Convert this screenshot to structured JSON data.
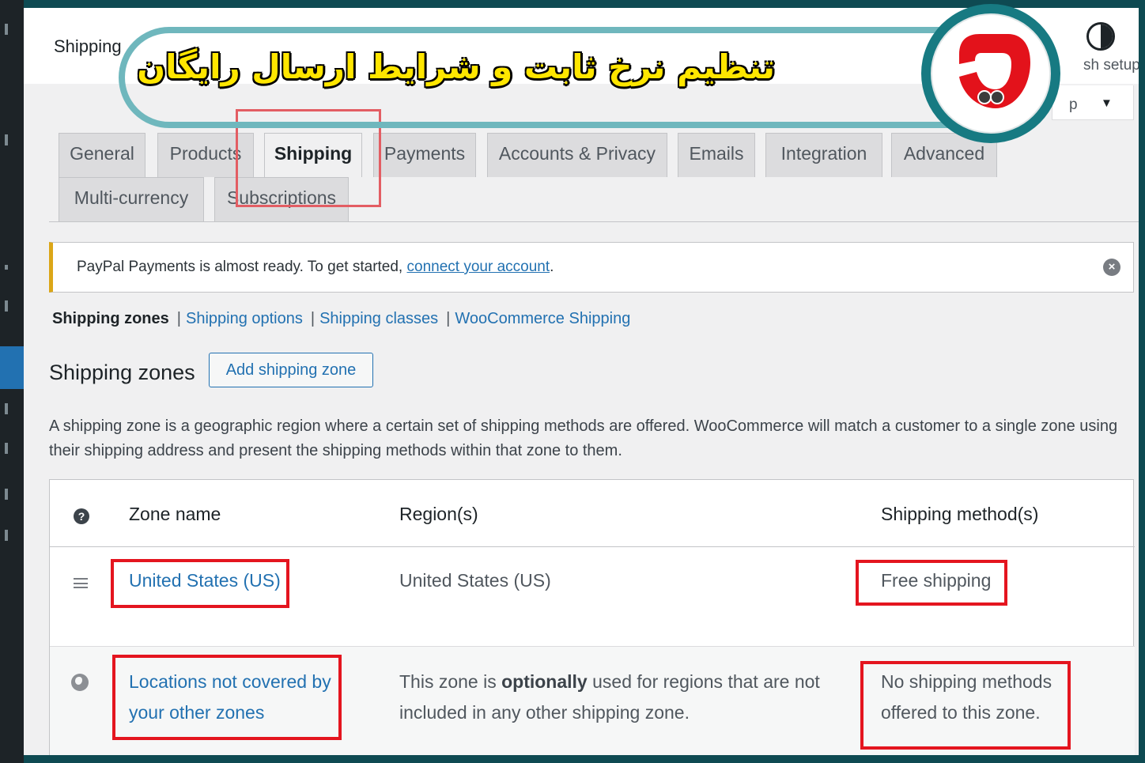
{
  "header": {
    "page_title": "Shipping",
    "finish_setup": "sh setup",
    "help_label": "p",
    "help_caret": "▼"
  },
  "banner": {
    "text": "تنظیم نرخ ثابت و شرایط ارسال رایگان"
  },
  "tabs": [
    {
      "label": "General"
    },
    {
      "label": "Products"
    },
    {
      "label": "Shipping"
    },
    {
      "label": "Payments"
    },
    {
      "label": "Accounts & Privacy"
    },
    {
      "label": "Emails"
    },
    {
      "label": "Integration"
    },
    {
      "label": "Advanced"
    },
    {
      "label": "Multi-currency"
    },
    {
      "label": "Subscriptions"
    }
  ],
  "notice": {
    "text": "PayPal Payments is almost ready. To get started, ",
    "link": "connect your account",
    "suffix": ".",
    "close_glyph": "×"
  },
  "subnav": {
    "current": "Shipping zones",
    "separator": "|",
    "links": [
      "Shipping options",
      "Shipping classes",
      "WooCommerce Shipping"
    ]
  },
  "zones": {
    "heading": "Shipping zones",
    "add_button": "Add shipping zone",
    "description": "A shipping zone is a geographic region where a certain set of shipping methods are offered. WooCommerce will match a customer to a single zone using their shipping address and present the shipping methods within that zone to them."
  },
  "table": {
    "help_glyph": "?",
    "headers": {
      "zone_name": "Zone name",
      "regions": "Region(s)",
      "methods": "Shipping method(s)"
    },
    "rows": [
      {
        "zone": "United States (US)",
        "region": "United States (US)",
        "methods": "Free shipping"
      },
      {
        "zone_line1": "Locations not covered by",
        "zone_line2": "your other zones",
        "region_pre": "This zone is ",
        "region_bold": "optionally",
        "region_post": " used for regions that are not",
        "region_line2": "included in any other shipping zone.",
        "methods_line1": "No shipping methods",
        "methods_line2": "offered to this zone."
      }
    ]
  },
  "colors": {
    "accent": "#2271b1",
    "highlight": "#e4151f",
    "banner_border": "#6fb7bd",
    "banner_text": "#ffe600",
    "logo_ring": "#177a82",
    "logo_red": "#e3121b"
  },
  "icons": [
    "contrast-icon",
    "close-icon",
    "help-icon",
    "drag-handle-icon",
    "globe-icon",
    "logo-icon"
  ]
}
